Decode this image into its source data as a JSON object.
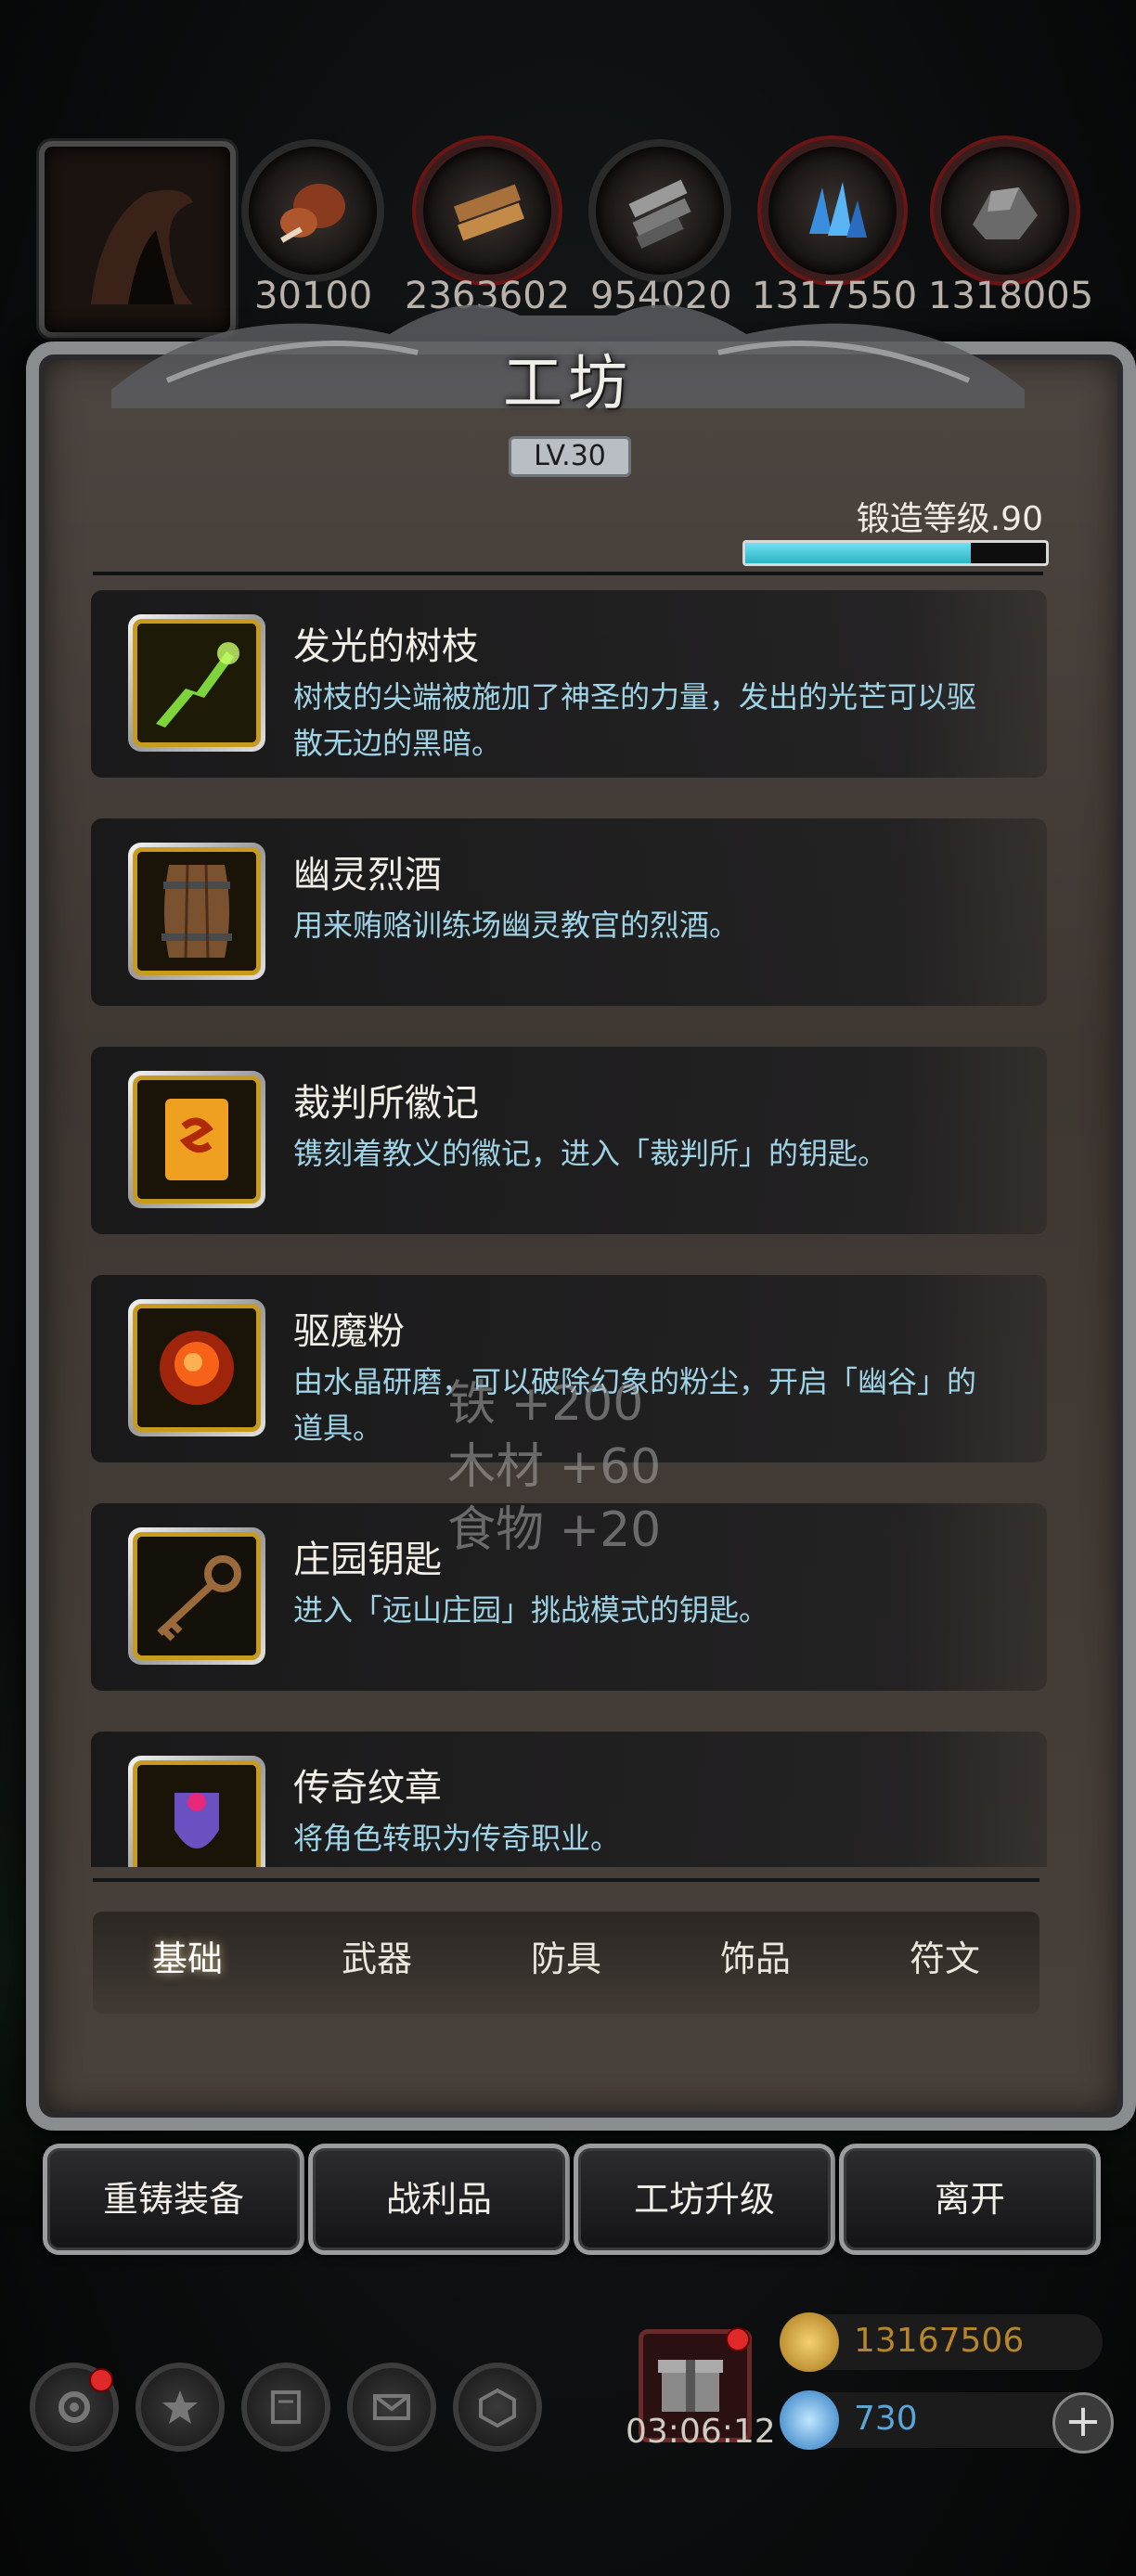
{
  "resources": [
    {
      "icon": "meat-icon",
      "value": "30100"
    },
    {
      "icon": "wood-icon",
      "value": "2363602"
    },
    {
      "icon": "iron-icon",
      "value": "954020"
    },
    {
      "icon": "crystal-icon",
      "value": "1317550"
    },
    {
      "icon": "ore-icon",
      "value": "1318005"
    }
  ],
  "workshop": {
    "title": "工坊",
    "level": "LV.30",
    "forge_level_label": "锻造等级.90",
    "forge_progress": 0.75
  },
  "items": [
    {
      "name": "发光的树枝",
      "desc": "树枝的尖端被施加了神圣的力量，发出的光芒可以驱散无边的黑暗。",
      "icon": "glowing-branch-icon"
    },
    {
      "name": "幽灵烈酒",
      "desc": "用来贿赂训练场幽灵教官的烈酒。",
      "icon": "barrel-icon"
    },
    {
      "name": "裁判所徽记",
      "desc": "镌刻着教义的徽记，进入「裁判所」的钥匙。",
      "icon": "emblem-icon"
    },
    {
      "name": "驱魔粉",
      "desc": "由水晶研磨，可以破除幻象的粉尘，开启「幽谷」的道具。",
      "icon": "powder-icon"
    },
    {
      "name": "庄园钥匙",
      "desc": "进入「远山庄园」挑战模式的钥匙。",
      "icon": "key-icon"
    },
    {
      "name": "传奇纹章",
      "desc": "将角色转职为传奇职业。",
      "icon": "crest-icon"
    }
  ],
  "gains": [
    "铁 +200",
    "木材 +60",
    "食物 +20"
  ],
  "tabs": [
    "基础",
    "武器",
    "防具",
    "饰品",
    "符文"
  ],
  "active_tab": "基础",
  "actions": [
    "重铸装备",
    "战利品",
    "工坊升级",
    "离开"
  ],
  "hud": {
    "timer": "03:06:12",
    "gold": "13167506",
    "gems": "730",
    "plus": "+"
  },
  "colors": {
    "desc_text": "#9fd3e6",
    "gold_text": "#b8862a",
    "gem_text": "#5aa6d8",
    "forge_fill": "#2bb3c6",
    "icon_border": "#c79b1e"
  }
}
